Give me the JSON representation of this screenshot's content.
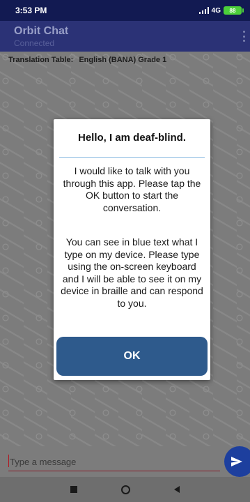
{
  "status_bar": {
    "time": "3:53 PM",
    "network": "4G",
    "battery": "88"
  },
  "app_bar": {
    "title": "Orbit Chat",
    "subtitle": "Connected",
    "menu_icon": "more-vert-icon"
  },
  "chat": {
    "translation_label": "Translation Table:",
    "translation_value": "English (BANA) Grade 1"
  },
  "dialog": {
    "title": "Hello, I am deaf-blind.",
    "paragraph1": "I would like to talk with you through this app. Please tap the OK button to start the conversation.",
    "paragraph2": "You can see in blue text what I type on my device. Please type using the on-screen keyboard and I will be able to see it on my device in braille and can respond to you.",
    "ok_label": "OK"
  },
  "input": {
    "placeholder": "Type a message",
    "send_icon": "send-icon"
  },
  "nav": {
    "recent_icon": "recent-apps-icon",
    "home_icon": "home-icon",
    "back_icon": "back-icon"
  },
  "colors": {
    "status_bar": "#121a52",
    "app_bar": "#2b3276",
    "ok_button": "#2e5a8c",
    "send_button": "#1d3f9e",
    "battery": "#4ccf3a"
  }
}
